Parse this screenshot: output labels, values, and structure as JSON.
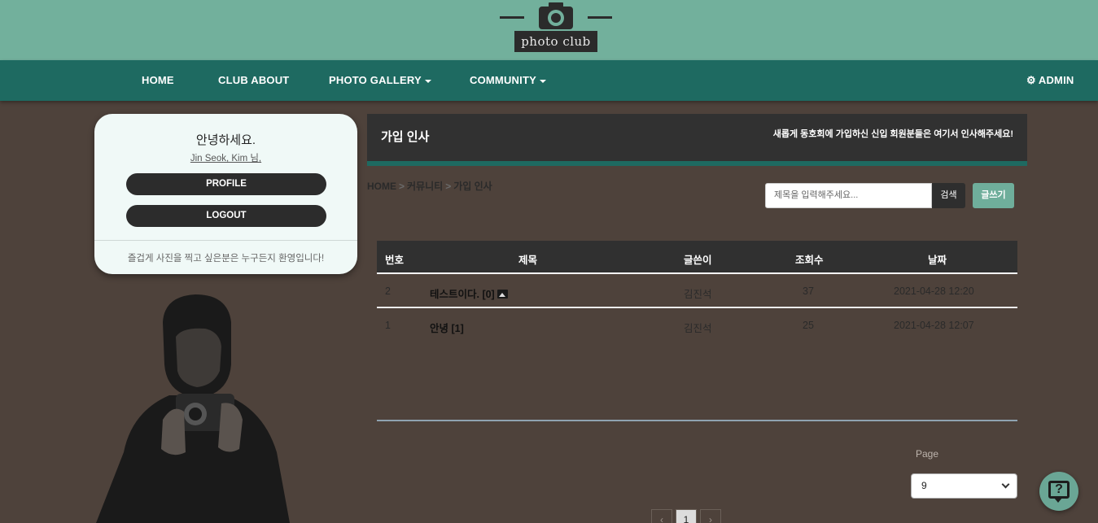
{
  "brand": {
    "logo_text": "photo club"
  },
  "nav": {
    "home": "HOME",
    "club_about": "CLUB ABOUT",
    "photo_gallery": "PHOTO GALLERY",
    "community": "COMMUNITY",
    "admin": "ADMIN"
  },
  "profile_card": {
    "greeting": "안녕하세요.",
    "user_name": "Jin Seok, Kim 님,",
    "profile_label": "PROFILE",
    "logout_label": "LOGOUT",
    "footer": "즐겁게 사진을 찍고 싶은분은 누구든지 환영입니다!"
  },
  "page_header": {
    "title": "가입 인사",
    "description": "새롭게 동호회에 가입하신 신입 회원분들은 여기서 인사해주세요!"
  },
  "breadcrumb": [
    "HOME",
    "커뮤니티",
    "가입 인사"
  ],
  "search": {
    "placeholder": "제목을 입력해주세요...",
    "button": "검색",
    "write_button": "글쓰기"
  },
  "table": {
    "columns": [
      "번호",
      "제목",
      "글쓴이",
      "조회수",
      "날짜"
    ],
    "rows": [
      {
        "no": "2",
        "title": "테스트이다. [0]",
        "has_image": true,
        "author": "김진석",
        "views": "37",
        "date": "2021-04-28 12:20"
      },
      {
        "no": "1",
        "title": "안녕 [1]",
        "has_image": false,
        "author": "김진석",
        "views": "25",
        "date": "2021-04-28 12:07"
      }
    ]
  },
  "pagination": {
    "page_label": "Page",
    "page_size": "9",
    "prev": "‹",
    "current": "1",
    "next": "›"
  },
  "colors": {
    "banner": "#72b09c",
    "nav": "#1e6a61",
    "background": "#4e423b",
    "accent": "#6fae9b"
  },
  "icons": {
    "admin": "gear-icon",
    "help": "help-chat-icon",
    "logo": "camera-icon"
  }
}
